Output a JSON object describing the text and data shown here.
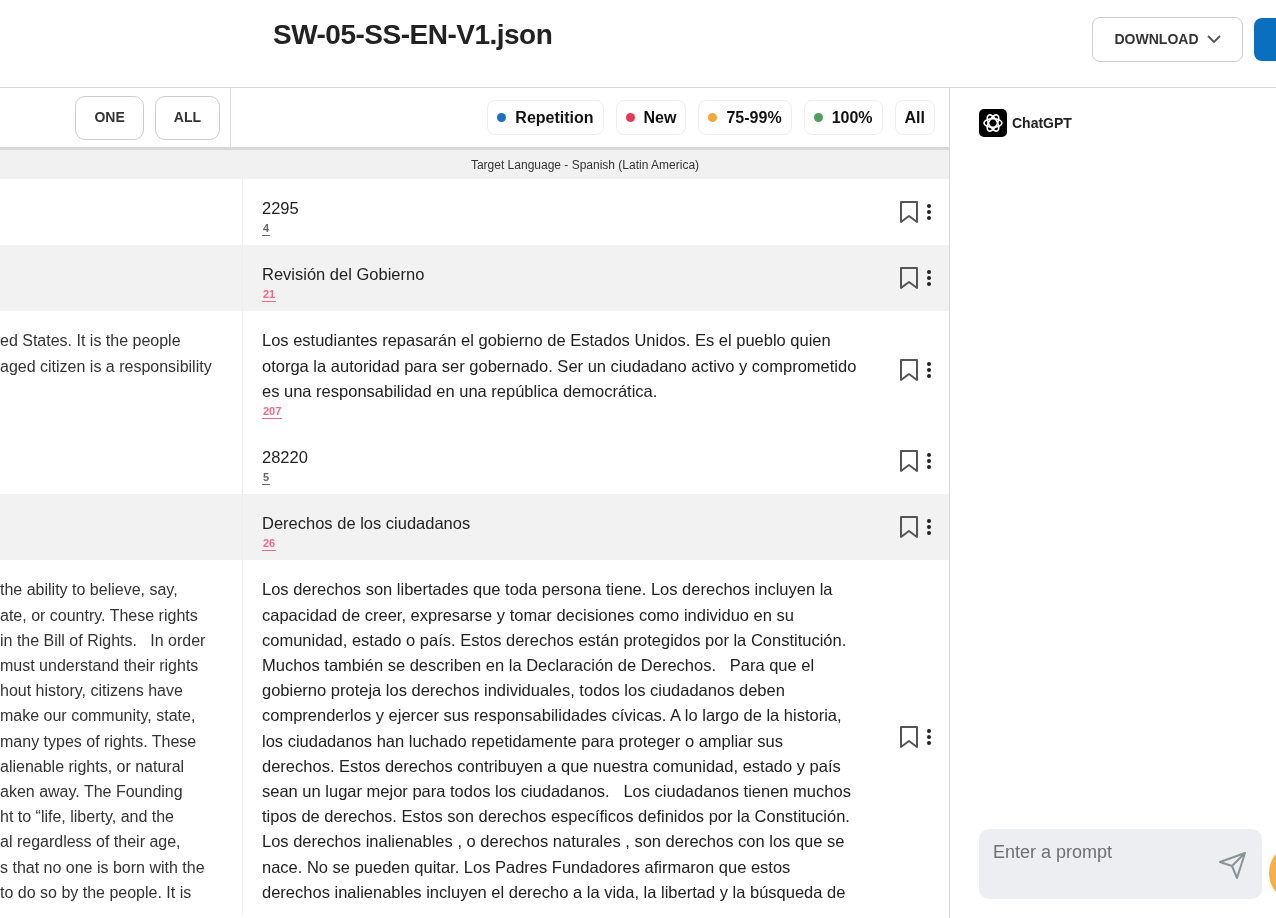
{
  "header": {
    "title": "SW-05-SS-EN-V1.json",
    "download_button": "DOWNLOAD"
  },
  "toolbar": {
    "buttons": [
      "ONE",
      "ALL"
    ],
    "filters": [
      {
        "label": "Repetition",
        "color": "#1f6fbf"
      },
      {
        "label": "New",
        "color": "#e8384f"
      },
      {
        "label": "75-99%",
        "color": "#f5a83a"
      },
      {
        "label": "100%",
        "color": "#4ea05a"
      },
      {
        "label": "All"
      }
    ]
  },
  "target_language": "Target Language - Spanish (Latin America)",
  "segments": [
    {
      "target": "2295",
      "count": "4",
      "color": "#666666",
      "shaded": false
    },
    {
      "target": "Revisión del Gobierno",
      "count": "21",
      "color": "#f06a85",
      "shaded": true
    },
    {
      "source_lines": [
        "ed States. It is the people",
        "aged citizen is a responsibility"
      ],
      "target": "Los estudiantes repasarán el gobierno de Estados Unidos. Es el pueblo quien otorga la autoridad para ser gobernado. Ser un ciudadano activo y comprometido es una responsabilidad en una república democrática.",
      "count": "207",
      "color": "#f06a85",
      "shaded": false
    },
    {
      "target": "28220",
      "count": "5",
      "color": "#666666",
      "shaded": false
    },
    {
      "target": "Derechos de los ciudadanos",
      "count": "26",
      "color": "#f06a85",
      "shaded": true
    },
    {
      "source_lines": [
        "the ability to believe, say,",
        "ate, or country. These rights",
        "in the Bill of Rights.   In order",
        "must understand their rights",
        "hout history, citizens have",
        "make our community, state,",
        "many types of rights. These",
        "alienable rights, or natural",
        "aken away. The Founding",
        "ht to “life, liberty, and the",
        "al regardless of their age,",
        "s that no one is born with the",
        "to do so by the people. It is"
      ],
      "target": "Los derechos son libertades que toda persona tiene. Los derechos incluyen la capacidad de creer, expresarse y tomar decisiones como individuo en su comunidad, estado o país. Estos derechos están protegidos por la Constitución. Muchos también se describen en la Declaración de Derechos.   Para que el gobierno proteja los derechos individuales, todos los ciudadanos deben comprenderlos y ejercer sus responsabilidades cívicas. A lo largo de la historia, los ciudadanos han luchado repetidamente para proteger o ampliar sus derechos. Estos derechos contribuyen a que nuestra comunidad, estado y país sean un lugar mejor para todos los ciudadanos.   Los ciudadanos tienen muchos tipos de derechos. Estos son derechos específicos definidos por la Constitución. Los derechos inalienables , o derechos naturales , son derechos con los que se nace. No se pueden quitar. Los Padres Fundadores afirmaron que estos derechos inalienables incluyen el derecho a la vida, la libertad y la búsqueda de",
      "shaded": false
    }
  ],
  "assistant": {
    "name": "ChatGPT",
    "prompt_placeholder": "Enter a prompt"
  }
}
